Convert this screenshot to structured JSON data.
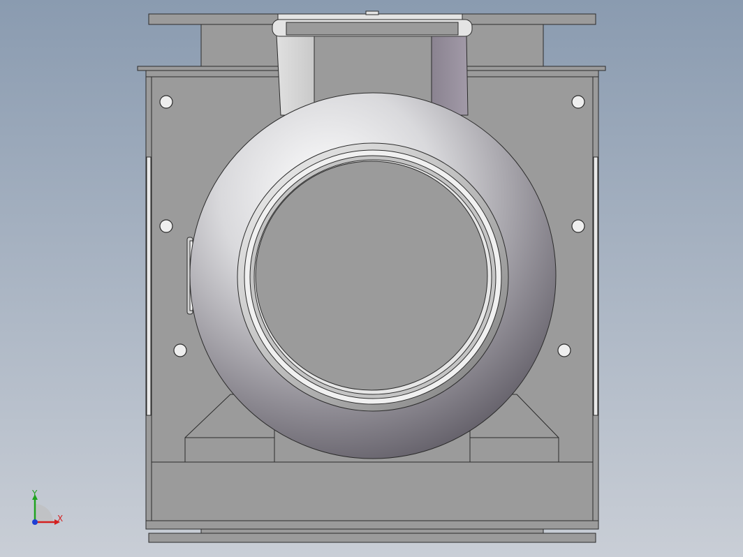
{
  "viewport": {
    "background_top": "#8a9bb0",
    "background_bottom": "#c9ced6",
    "part_color": "#9b9b9b",
    "edge_color": "#2b2b2b"
  },
  "triad": {
    "x_label": "X",
    "y_label": "Y",
    "x_color": "#d42020",
    "y_color": "#1fa31f",
    "z_color": "#1f3fd4"
  }
}
